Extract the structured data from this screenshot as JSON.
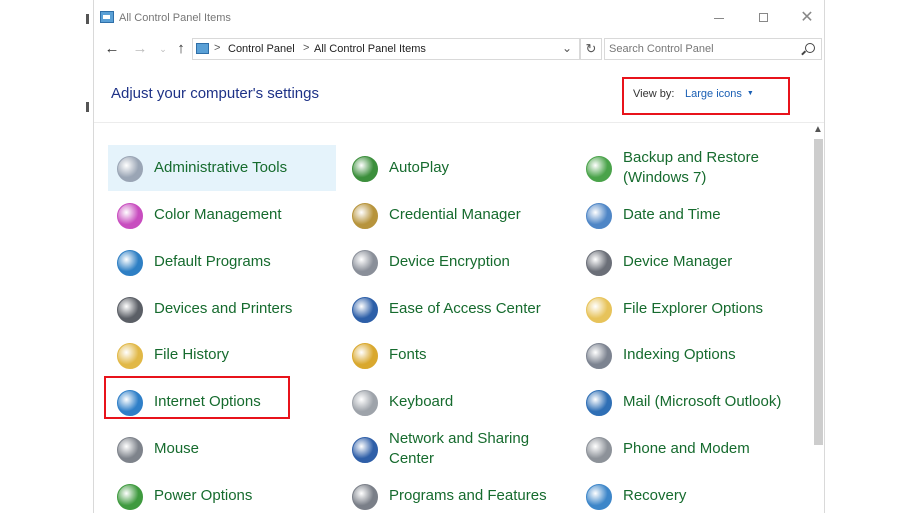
{
  "window": {
    "title": "All Control Panel Items",
    "close_glyph": "✕"
  },
  "nav": {
    "back_glyph": "←",
    "forward_glyph": "→",
    "recent_glyph": "⌄",
    "up_glyph": "↑",
    "breadcrumb": [
      "Control Panel",
      "All Control Panel Items"
    ],
    "separator": ">",
    "dropdown_glyph": "⌄",
    "refresh_glyph": "↻"
  },
  "search": {
    "placeholder": "Search Control Panel"
  },
  "header": {
    "heading": "Adjust your computer's settings",
    "view_by_label": "View by:",
    "view_by_value": "Large icons",
    "view_by_caret": "▼"
  },
  "scrollbar": {
    "up_glyph": "▲"
  },
  "colors": {
    "link_green": "#166b2e",
    "heading_blue": "#1e3287",
    "highlight_red": "#e8131b",
    "selected_bg": "#e5f3fb"
  },
  "items": [
    {
      "label": "Administrative Tools",
      "icon": "administrative-tools-icon",
      "color": "#9aa5b5"
    },
    {
      "label": "AutoPlay",
      "icon": "autoplay-icon",
      "color": "#3c8f3c"
    },
    {
      "label": "Backup and Restore (Windows 7)",
      "icon": "backup-restore-icon",
      "color": "#4aa34a"
    },
    {
      "label": "Color Management",
      "icon": "color-management-icon",
      "color": "#c84dbf"
    },
    {
      "label": "Credential Manager",
      "icon": "credential-manager-icon",
      "color": "#b7943c"
    },
    {
      "label": "Date and Time",
      "icon": "date-time-icon",
      "color": "#4f86c6"
    },
    {
      "label": "Default Programs",
      "icon": "default-programs-icon",
      "color": "#2e7fc4"
    },
    {
      "label": "Device Encryption",
      "icon": "device-encryption-icon",
      "color": "#8a8f99"
    },
    {
      "label": "Device Manager",
      "icon": "device-manager-icon",
      "color": "#6b6f78"
    },
    {
      "label": "Devices and Printers",
      "icon": "devices-printers-icon",
      "color": "#5b5f66"
    },
    {
      "label": "Ease of Access Center",
      "icon": "ease-of-access-icon",
      "color": "#2d5fa8"
    },
    {
      "label": "File Explorer Options",
      "icon": "file-explorer-options-icon",
      "color": "#e7c35a"
    },
    {
      "label": "File History",
      "icon": "file-history-icon",
      "color": "#e1b847"
    },
    {
      "label": "Fonts",
      "icon": "fonts-icon",
      "color": "#d9a82e"
    },
    {
      "label": "Indexing Options",
      "icon": "indexing-options-icon",
      "color": "#7c8390"
    },
    {
      "label": "Internet Options",
      "icon": "internet-options-icon",
      "color": "#2f7fc8"
    },
    {
      "label": "Keyboard",
      "icon": "keyboard-icon",
      "color": "#9ea3aa"
    },
    {
      "label": "Mail (Microsoft Outlook)",
      "icon": "mail-icon",
      "color": "#2f6fb5"
    },
    {
      "label": "Mouse",
      "icon": "mouse-icon",
      "color": "#7e838b"
    },
    {
      "label": "Network and Sharing Center",
      "icon": "network-sharing-icon",
      "color": "#2f5fa8"
    },
    {
      "label": "Phone and Modem",
      "icon": "phone-modem-icon",
      "color": "#8d9299"
    },
    {
      "label": "Power Options",
      "icon": "power-options-icon",
      "color": "#3f9a3f"
    },
    {
      "label": "Programs and Features",
      "icon": "programs-features-icon",
      "color": "#7a7f88"
    },
    {
      "label": "Recovery",
      "icon": "recovery-icon",
      "color": "#3d86c9"
    }
  ]
}
